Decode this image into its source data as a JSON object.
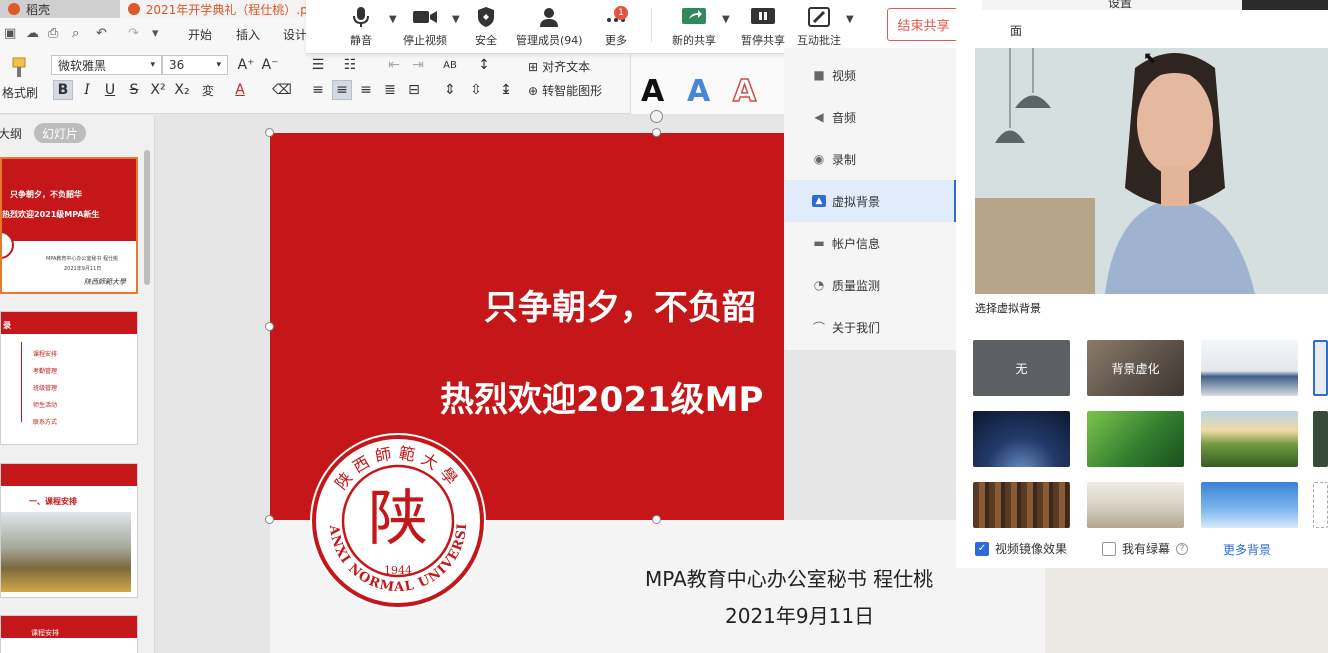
{
  "window": {
    "tab1_title": "稻壳",
    "tab2_title": "2021年开学典礼（程仕桃）.pp"
  },
  "ribbon": {
    "menu": [
      "开始",
      "插入",
      "设计"
    ],
    "format_painter": "格式刷",
    "font_name": "微软雅黑",
    "font_size": "36",
    "align_text": "对齐文本",
    "smart_shape": "转智能图形",
    "style_letter": "A"
  },
  "left_panel": {
    "tab_outline": "大纲",
    "tab_slides": "幻灯片",
    "thumb1": {
      "line1": "只争朝夕，不负韶华",
      "line2": "热烈欢迎2021级MPA新生",
      "line3": "MPA教育中心办公室秘书 程仕桃",
      "line4": "2021年9月11日",
      "signature": "陕西師範大學"
    },
    "thumb2": {
      "header": "录",
      "items": [
        "课程安排",
        "考勤管理",
        "班级管理",
        "师生活动",
        "联系方式"
      ]
    },
    "thumb3": {
      "header": "一、课程安排"
    },
    "thumb4": {
      "header": "课程安排"
    }
  },
  "slide": {
    "title_line1": "只争朝夕，不负韶",
    "title_line2": "热烈欢迎2021级MP",
    "subtitle_line1": "MPA教育中心办公室秘书 程仕桃",
    "subtitle_line2": "2021年9月11日",
    "seal": {
      "center_char": "陕",
      "top_text": "陕西師範大學",
      "bottom_text": "SHANXI NORMAL UNIVERSITY",
      "year": "1944"
    }
  },
  "meeting_toolbar": {
    "mute": "静音",
    "stop_video": "停止视频",
    "security": "安全",
    "participants": "管理成员(94)",
    "more": "更多",
    "more_badge": "1",
    "new_share": "新的共享",
    "pause_share": "暂停共享",
    "annotate": "互动批注",
    "end_share": "结束共享"
  },
  "settings": {
    "header_title": "设置",
    "section_title": "面",
    "nav": [
      {
        "label": "视频",
        "icon": "video-icon"
      },
      {
        "label": "音频",
        "icon": "speaker-icon"
      },
      {
        "label": "录制",
        "icon": "record-icon"
      },
      {
        "label": "虚拟背景",
        "icon": "person-icon"
      },
      {
        "label": "帐户信息",
        "icon": "card-icon"
      },
      {
        "label": "质量监测",
        "icon": "monitor-icon"
      },
      {
        "label": "关于我们",
        "icon": "logo-icon"
      }
    ],
    "active_nav": "虚拟背景",
    "choose_bg": "选择虚拟背景",
    "bg_none": "无",
    "bg_blur": "背景虚化",
    "mirror": "视频镜像效果",
    "mirror_checked": true,
    "green_screen": "我有绿幕",
    "green_checked": false,
    "more_bg": "更多背景"
  },
  "colors": {
    "slide_red": "#c5171a",
    "accent_blue": "#2e6bd9",
    "stop_red": "#e05a4e"
  }
}
